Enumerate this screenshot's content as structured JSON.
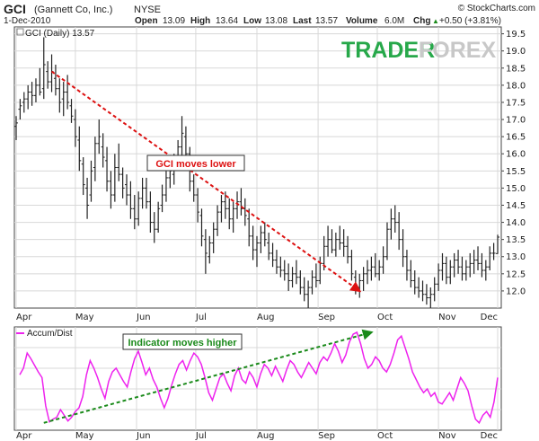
{
  "header": {
    "symbol": "GCI",
    "company": "(Gannett Co, Inc.)",
    "exchange": "NYSE",
    "credit": "© StockCharts.com",
    "date": "1-Dec-2010",
    "open_label": "Open",
    "open_value": "13.09",
    "high_label": "High",
    "high_value": "13.64",
    "low_label": "Low",
    "low_value": "13.08",
    "last_label": "Last",
    "last_value": "13.57",
    "volume_label": "Volume",
    "volume_value": "6.0M",
    "chg_label": "Chg",
    "chg_value": "+0.50 (+3.81%)",
    "chg_arrow": "▲"
  },
  "price_panel": {
    "legend": "GCI (Daily) 13.57",
    "watermark_left": "TRADER",
    "watermark_right": "FOREX"
  },
  "indicator_panel": {
    "legend": "Accum/Dist"
  },
  "colors": {
    "price_bars": "#222222",
    "ad_line": "#ee22ee",
    "down_trend": "#dd1111",
    "up_trend": "#1a8a1a",
    "grid": "#d8d8d8",
    "watermark_green": "#27a84a",
    "watermark_gray": "#c8c8c8"
  },
  "chart_data": [
    {
      "type": "ohlc",
      "title": "GCI (Daily) 13.57",
      "x_ticks": [
        "Apr",
        "May",
        "Jun",
        "Jul",
        "Aug",
        "Sep",
        "Oct",
        "Nov",
        "Dec"
      ],
      "y_ticks": [
        12.0,
        12.5,
        13.0,
        13.5,
        14.0,
        14.5,
        15.0,
        15.5,
        16.0,
        16.5,
        17.0,
        17.5,
        18.0,
        18.5,
        19.0,
        19.5
      ],
      "ylim": [
        11.5,
        19.7
      ],
      "y_side": "right",
      "grid": true,
      "x_start": "2010-04-01",
      "x_end": "2010-12-01",
      "bars": [
        [
          "2010-04-01",
          16.8,
          17.1,
          16.4,
          16.9
        ],
        [
          "2010-04-03",
          17.3,
          17.6,
          17.0,
          17.4
        ],
        [
          "2010-04-05",
          17.5,
          17.8,
          17.2,
          17.6
        ],
        [
          "2010-04-07",
          17.6,
          18.0,
          17.3,
          17.8
        ],
        [
          "2010-04-09",
          17.8,
          18.1,
          17.4,
          17.7
        ],
        [
          "2010-04-11",
          17.7,
          18.2,
          17.5,
          18.0
        ],
        [
          "2010-04-13",
          18.0,
          18.5,
          17.7,
          17.8
        ],
        [
          "2010-04-15",
          17.9,
          19.4,
          17.6,
          18.6
        ],
        [
          "2010-04-17",
          18.4,
          18.7,
          17.9,
          18.1
        ],
        [
          "2010-04-19",
          18.1,
          18.9,
          17.8,
          18.4
        ],
        [
          "2010-04-21",
          18.2,
          18.6,
          17.7,
          17.9
        ],
        [
          "2010-04-23",
          17.9,
          18.2,
          17.2,
          17.5
        ],
        [
          "2010-04-25",
          17.6,
          18.1,
          17.1,
          17.8
        ],
        [
          "2010-04-27",
          17.8,
          18.3,
          17.3,
          17.5
        ],
        [
          "2010-04-29",
          17.4,
          17.6,
          16.9,
          17.1
        ],
        [
          "2010-05-01",
          17.0,
          17.3,
          16.2,
          16.5
        ],
        [
          "2010-05-03",
          16.4,
          16.8,
          15.5,
          15.8
        ],
        [
          "2010-05-05",
          15.7,
          15.9,
          14.8,
          15.1
        ],
        [
          "2010-05-07",
          15.0,
          15.3,
          14.1,
          14.5
        ],
        [
          "2010-05-09",
          14.8,
          15.8,
          14.6,
          15.5
        ],
        [
          "2010-05-11",
          15.6,
          16.5,
          15.2,
          16.3
        ],
        [
          "2010-05-13",
          16.3,
          17.0,
          16.0,
          16.5
        ],
        [
          "2010-05-15",
          16.2,
          16.6,
          15.6,
          15.9
        ],
        [
          "2010-05-17",
          15.8,
          16.2,
          14.9,
          15.2
        ],
        [
          "2010-05-19",
          15.2,
          15.5,
          14.4,
          14.8
        ],
        [
          "2010-05-21",
          14.8,
          16.0,
          14.6,
          15.6
        ],
        [
          "2010-05-23",
          15.6,
          16.3,
          15.2,
          15.4
        ],
        [
          "2010-05-25",
          15.4,
          15.6,
          14.7,
          15.0
        ],
        [
          "2010-05-27",
          15.1,
          15.4,
          14.5,
          14.8
        ],
        [
          "2010-05-29",
          14.8,
          15.2,
          14.1,
          14.4
        ],
        [
          "2010-05-31",
          14.4,
          14.8,
          13.8,
          14.1
        ],
        [
          "2010-06-02",
          14.1,
          14.9,
          13.9,
          14.7
        ],
        [
          "2010-06-04",
          14.7,
          15.3,
          14.4,
          15.0
        ],
        [
          "2010-06-06",
          15.0,
          15.3,
          14.4,
          14.6
        ],
        [
          "2010-06-08",
          14.6,
          14.9,
          13.7,
          14.0
        ],
        [
          "2010-06-10",
          14.0,
          14.3,
          13.4,
          13.8
        ],
        [
          "2010-06-12",
          13.8,
          14.6,
          13.7,
          14.4
        ],
        [
          "2010-06-14",
          14.5,
          15.1,
          14.3,
          14.8
        ],
        [
          "2010-06-16",
          14.8,
          15.6,
          14.6,
          15.3
        ],
        [
          "2010-06-18",
          15.3,
          15.8,
          15.0,
          15.5
        ],
        [
          "2010-06-20",
          15.4,
          16.0,
          15.1,
          15.8
        ],
        [
          "2010-06-22",
          15.8,
          16.4,
          15.5,
          16.2
        ],
        [
          "2010-06-24",
          16.2,
          17.1,
          15.9,
          16.6
        ],
        [
          "2010-06-26",
          16.5,
          16.8,
          15.7,
          16.0
        ],
        [
          "2010-06-28",
          16.0,
          16.2,
          14.9,
          15.2
        ],
        [
          "2010-06-30",
          15.2,
          15.4,
          14.6,
          14.8
        ],
        [
          "2010-07-02",
          14.8,
          15.0,
          14.0,
          14.3
        ],
        [
          "2010-07-04",
          14.2,
          14.4,
          13.3,
          13.6
        ],
        [
          "2010-07-06",
          13.5,
          13.8,
          12.5,
          13.1
        ],
        [
          "2010-07-08",
          13.0,
          13.6,
          12.8,
          13.4
        ],
        [
          "2010-07-10",
          13.4,
          14.0,
          13.1,
          13.8
        ],
        [
          "2010-07-12",
          13.8,
          14.5,
          13.6,
          14.3
        ],
        [
          "2010-07-14",
          14.3,
          14.8,
          14.0,
          14.6
        ],
        [
          "2010-07-16",
          14.6,
          14.9,
          14.1,
          14.4
        ],
        [
          "2010-07-18",
          14.4,
          14.7,
          13.8,
          14.1
        ],
        [
          "2010-07-20",
          14.1,
          14.6,
          13.7,
          14.4
        ],
        [
          "2010-07-22",
          14.4,
          14.9,
          14.1,
          14.6
        ],
        [
          "2010-07-24",
          14.6,
          15.0,
          14.2,
          14.4
        ],
        [
          "2010-07-26",
          14.4,
          14.7,
          13.9,
          14.2
        ],
        [
          "2010-07-28",
          14.1,
          14.4,
          13.3,
          13.6
        ],
        [
          "2010-07-30",
          13.6,
          13.9,
          12.9,
          13.2
        ],
        [
          "2010-08-01",
          13.2,
          13.6,
          12.7,
          13.4
        ],
        [
          "2010-08-03",
          13.4,
          13.9,
          13.1,
          13.7
        ],
        [
          "2010-08-05",
          13.7,
          14.0,
          13.3,
          13.5
        ],
        [
          "2010-08-07",
          13.4,
          13.7,
          12.9,
          13.1
        ],
        [
          "2010-08-09",
          13.1,
          13.4,
          12.7,
          12.9
        ],
        [
          "2010-08-11",
          12.9,
          13.2,
          12.5,
          12.7
        ],
        [
          "2010-08-13",
          12.7,
          13.0,
          12.4,
          12.6
        ],
        [
          "2010-08-15",
          12.6,
          12.9,
          12.3,
          12.5
        ],
        [
          "2010-08-17",
          12.5,
          12.8,
          12.0,
          12.3
        ],
        [
          "2010-08-19",
          12.3,
          12.7,
          12.1,
          12.5
        ],
        [
          "2010-08-21",
          12.5,
          12.9,
          12.2,
          12.4
        ],
        [
          "2010-08-23",
          12.4,
          12.6,
          11.9,
          12.1
        ],
        [
          "2010-08-25",
          12.1,
          12.4,
          11.7,
          11.9
        ],
        [
          "2010-08-27",
          11.9,
          12.3,
          11.5,
          12.1
        ],
        [
          "2010-08-29",
          12.1,
          12.6,
          11.9,
          12.4
        ],
        [
          "2010-08-31",
          12.4,
          12.8,
          12.1,
          12.3
        ],
        [
          "2010-09-02",
          12.3,
          13.0,
          12.2,
          12.8
        ],
        [
          "2010-09-04",
          12.8,
          13.6,
          12.6,
          13.3
        ],
        [
          "2010-09-06",
          13.3,
          13.9,
          13.0,
          13.5
        ],
        [
          "2010-09-08",
          13.5,
          13.8,
          13.1,
          13.2
        ],
        [
          "2010-09-10",
          13.2,
          13.7,
          13.0,
          13.5
        ],
        [
          "2010-09-12",
          13.5,
          13.9,
          13.2,
          13.4
        ],
        [
          "2010-09-14",
          13.4,
          13.8,
          13.0,
          13.3
        ],
        [
          "2010-09-16",
          13.3,
          13.6,
          12.8,
          13.0
        ],
        [
          "2010-09-18",
          13.0,
          13.2,
          12.3,
          12.5
        ],
        [
          "2010-09-20",
          12.4,
          12.6,
          11.9,
          12.1
        ],
        [
          "2010-09-22",
          12.1,
          12.5,
          11.8,
          12.3
        ],
        [
          "2010-09-24",
          12.3,
          12.7,
          12.0,
          12.5
        ],
        [
          "2010-09-26",
          12.5,
          12.9,
          12.2,
          12.6
        ],
        [
          "2010-09-28",
          12.6,
          13.0,
          12.3,
          12.7
        ],
        [
          "2010-09-30",
          12.7,
          13.1,
          12.4,
          12.5
        ],
        [
          "2010-10-02",
          12.5,
          12.9,
          12.3,
          12.7
        ],
        [
          "2010-10-04",
          12.7,
          13.3,
          12.5,
          13.0
        ],
        [
          "2010-10-06",
          13.0,
          14.0,
          12.9,
          13.8
        ],
        [
          "2010-10-08",
          13.8,
          14.4,
          13.5,
          14.1
        ],
        [
          "2010-10-10",
          14.1,
          14.5,
          13.7,
          14.0
        ],
        [
          "2010-10-12",
          14.0,
          14.3,
          13.2,
          13.5
        ],
        [
          "2010-10-14",
          13.5,
          13.8,
          12.7,
          13.0
        ],
        [
          "2010-10-16",
          13.0,
          13.2,
          12.3,
          12.6
        ],
        [
          "2010-10-18",
          12.6,
          12.9,
          12.1,
          12.3
        ],
        [
          "2010-10-20",
          12.3,
          12.6,
          11.9,
          12.1
        ],
        [
          "2010-10-22",
          12.1,
          12.4,
          11.8,
          12.0
        ],
        [
          "2010-10-24",
          12.0,
          12.3,
          11.7,
          11.9
        ],
        [
          "2010-10-26",
          11.9,
          12.2,
          11.6,
          11.8
        ],
        [
          "2010-10-28",
          11.8,
          12.1,
          11.5,
          11.9
        ],
        [
          "2010-10-30",
          11.9,
          12.4,
          11.7,
          12.2
        ],
        [
          "2010-11-01",
          12.2,
          12.8,
          12.0,
          12.6
        ],
        [
          "2010-11-03",
          12.6,
          13.1,
          12.3,
          12.8
        ],
        [
          "2010-11-05",
          12.8,
          13.0,
          12.2,
          12.4
        ],
        [
          "2010-11-07",
          12.4,
          12.9,
          12.2,
          12.7
        ],
        [
          "2010-11-09",
          12.7,
          13.1,
          12.4,
          12.9
        ],
        [
          "2010-11-11",
          12.9,
          13.2,
          12.5,
          12.7
        ],
        [
          "2010-11-13",
          12.7,
          13.0,
          12.3,
          12.5
        ],
        [
          "2010-11-15",
          12.5,
          12.9,
          12.3,
          12.7
        ],
        [
          "2010-11-17",
          12.7,
          13.1,
          12.4,
          12.8
        ],
        [
          "2010-11-19",
          12.8,
          13.2,
          12.5,
          12.9
        ],
        [
          "2010-11-21",
          12.9,
          13.3,
          12.6,
          12.8
        ],
        [
          "2010-11-23",
          12.8,
          13.1,
          12.4,
          12.6
        ],
        [
          "2010-11-25",
          12.6,
          12.9,
          12.3,
          12.7
        ],
        [
          "2010-11-27",
          12.7,
          13.3,
          12.6,
          13.1
        ],
        [
          "2010-11-29",
          13.1,
          13.4,
          12.9,
          13.1
        ],
        [
          "2010-12-01",
          13.09,
          13.64,
          13.08,
          13.57
        ]
      ],
      "annotations": [
        {
          "text": "GCI moves lower",
          "from": [
            "2010-04-19",
            18.4
          ],
          "to": [
            "2010-09-22",
            12.0
          ]
        }
      ]
    },
    {
      "type": "line",
      "title": "Accum/Dist",
      "x_ticks": [
        "Apr",
        "May",
        "Jun",
        "Jul",
        "Aug",
        "Sep",
        "Oct",
        "Nov",
        "Dec"
      ],
      "ylim": [
        0,
        1
      ],
      "y_axis_labels": false,
      "grid": true,
      "x_start": "2010-04-01",
      "x_end": "2010-12-01",
      "note": "relative level 0-1; no values printed on axis",
      "series": [
        {
          "values": [
            0.55,
            0.62,
            0.78,
            0.72,
            0.65,
            0.58,
            0.52,
            0.22,
            0.05,
            0.08,
            0.1,
            0.18,
            0.12,
            0.06,
            0.1,
            0.16,
            0.2,
            0.32,
            0.55,
            0.7,
            0.62,
            0.52,
            0.4,
            0.3,
            0.48,
            0.58,
            0.62,
            0.55,
            0.48,
            0.42,
            0.58,
            0.72,
            0.8,
            0.68,
            0.55,
            0.62,
            0.5,
            0.42,
            0.3,
            0.2,
            0.3,
            0.44,
            0.56,
            0.66,
            0.7,
            0.6,
            0.7,
            0.78,
            0.74,
            0.66,
            0.52,
            0.36,
            0.28,
            0.4,
            0.52,
            0.56,
            0.46,
            0.38,
            0.54,
            0.62,
            0.5,
            0.46,
            0.58,
            0.52,
            0.42,
            0.56,
            0.66,
            0.62,
            0.54,
            0.64,
            0.56,
            0.48,
            0.6,
            0.7,
            0.66,
            0.58,
            0.52,
            0.6,
            0.68,
            0.62,
            0.56,
            0.68,
            0.74,
            0.7,
            0.78,
            0.88,
            0.8,
            0.68,
            0.76,
            0.9,
            0.98,
            1.0,
            0.88,
            0.72,
            0.62,
            0.66,
            0.74,
            0.7,
            0.62,
            0.58,
            0.66,
            0.78,
            0.92,
            0.96,
            0.84,
            0.72,
            0.58,
            0.5,
            0.42,
            0.36,
            0.4,
            0.32,
            0.36,
            0.26,
            0.24,
            0.3,
            0.36,
            0.28,
            0.4,
            0.52,
            0.46,
            0.38,
            0.22,
            0.08,
            0.04,
            0.12,
            0.16,
            0.1,
            0.26,
            0.52
          ]
        }
      ],
      "annotations": [
        {
          "text": "Indicator moves higher",
          "from": [
            "2010-04-15",
            0.04
          ],
          "to": [
            "2010-09-28",
            1.0
          ]
        }
      ]
    }
  ]
}
